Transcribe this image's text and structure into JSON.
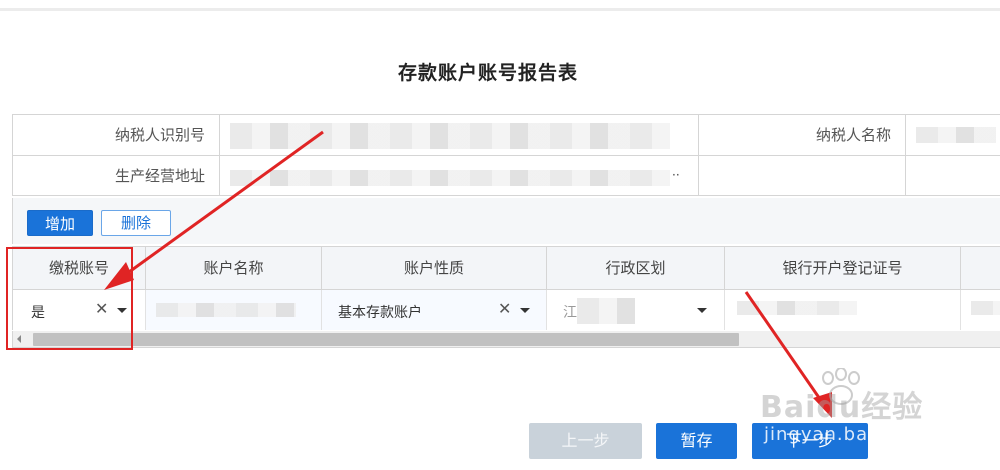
{
  "title": "存款账户账号报告表",
  "info": {
    "taxpayer_id_label": "纳税人识别号",
    "taxpayer_name_label": "纳税人名称",
    "address_label": "生产经营地址",
    "address_trailing": "··"
  },
  "toolbar": {
    "add_label": "增加",
    "delete_label": "删除"
  },
  "grid": {
    "columns": [
      "缴税账号",
      "账户名称",
      "账户性质",
      "行政区划",
      "银行开户登记证号"
    ],
    "row": {
      "tax_account": "是",
      "account_type": "基本存款账户",
      "region_prefix": "江"
    }
  },
  "footer": {
    "prev_label": "上一步",
    "save_label": "暂存",
    "next_label": "下一步"
  },
  "watermark": {
    "logo": "Baidu经验",
    "url": "jingyan.baidu.com"
  },
  "colors": {
    "primary": "#1a73d9",
    "annotation_red": "#e02424",
    "disabled": "#c9d2da"
  }
}
